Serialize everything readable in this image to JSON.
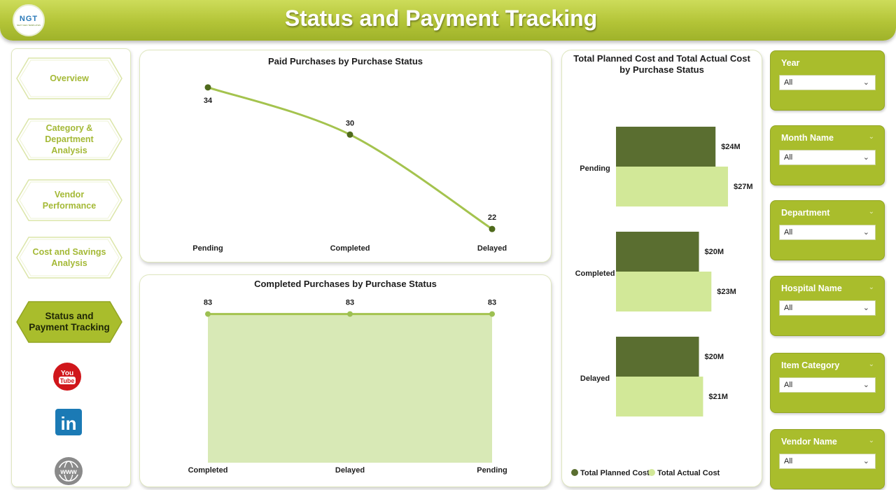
{
  "header": {
    "title": "Status and Payment Tracking",
    "logo_text": "NGT",
    "logo_subtext": "NEXT GEN TEMPLATES"
  },
  "nav": {
    "items": [
      {
        "label": "Overview",
        "active": false
      },
      {
        "label": "Category & Department Analysis",
        "active": false
      },
      {
        "label": "Vendor Performance",
        "active": false
      },
      {
        "label": "Cost and Savings Analysis",
        "active": false
      },
      {
        "label": "Status and Payment Tracking",
        "active": true
      }
    ],
    "social": [
      {
        "name": "youtube-icon",
        "text": "You Tube"
      },
      {
        "name": "linkedin-icon",
        "text": "in"
      },
      {
        "name": "website-icon",
        "text": "www"
      }
    ]
  },
  "colors": {
    "accent": "#a9bd2c",
    "line": "#a4c34e",
    "planned": "#5a6e30",
    "actual": "#d2e898",
    "area": "#d8e9b6"
  },
  "chart_data": [
    {
      "type": "line",
      "title": "Paid Purchases by Purchase Status",
      "categories": [
        "Pending",
        "Completed",
        "Delayed"
      ],
      "values": [
        34,
        30,
        22
      ]
    },
    {
      "type": "area",
      "title": "Completed Purchases by Purchase Status",
      "categories": [
        "Completed",
        "Delayed",
        "Pending"
      ],
      "values": [
        83,
        83,
        83
      ]
    },
    {
      "type": "bar",
      "orientation": "horizontal",
      "title": "Total Planned Cost and Total Actual Cost by Purchase Status",
      "categories": [
        "Pending",
        "Completed",
        "Delayed"
      ],
      "series": [
        {
          "name": "Total Planned Cost",
          "values": [
            24,
            20,
            20
          ],
          "labels": [
            "$24M",
            "$20M",
            "$20M"
          ]
        },
        {
          "name": "Total Actual Cost",
          "values": [
            27,
            23,
            21
          ],
          "labels": [
            "$27M",
            "$23M",
            "$21M"
          ]
        }
      ],
      "legend": "bottom-left"
    }
  ],
  "slicers": [
    {
      "label": "Year",
      "value": "All",
      "chevron": false
    },
    {
      "label": "Month Name",
      "value": "All",
      "chevron": true
    },
    {
      "label": "Department",
      "value": "All",
      "chevron": true
    },
    {
      "label": "Hospital Name",
      "value": "All",
      "chevron": true
    },
    {
      "label": "Item Category",
      "value": "All",
      "chevron": true
    },
    {
      "label": "Vendor Name",
      "value": "All",
      "chevron": true
    }
  ]
}
